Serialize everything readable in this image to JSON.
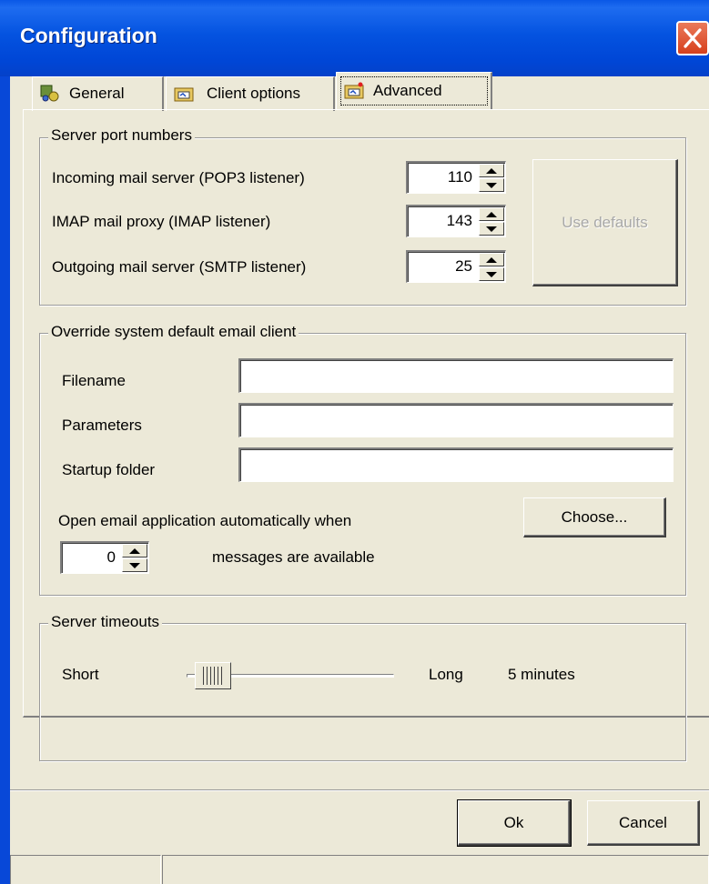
{
  "window": {
    "title": "Configuration"
  },
  "tabs": [
    {
      "label": "General",
      "icon": "general-settings-icon"
    },
    {
      "label": "Client options",
      "icon": "client-options-icon"
    },
    {
      "label": "Advanced",
      "icon": "advanced-icon",
      "active": true
    }
  ],
  "server_ports": {
    "title": "Server port numbers",
    "rows": [
      {
        "label": "Incoming mail server (POP3 listener)",
        "value": "110"
      },
      {
        "label": "IMAP mail proxy (IMAP listener)",
        "value": "143"
      },
      {
        "label": "Outgoing mail server (SMTP listener)",
        "value": "25"
      }
    ],
    "use_defaults_label": "Use defaults"
  },
  "override_client": {
    "title": "Override system default email client",
    "filename_label": "Filename",
    "filename_value": "",
    "parameters_label": "Parameters",
    "parameters_value": "",
    "startup_label": "Startup folder",
    "startup_value": "",
    "open_auto_label": "Open email application automatically when",
    "choose_label": "Choose...",
    "messages_count": "0",
    "messages_label": "messages are available"
  },
  "timeouts": {
    "title": "Server timeouts",
    "short_label": "Short",
    "long_label": "Long",
    "current_value": "5 minutes",
    "slider_level": 0.1
  },
  "footer": {
    "ok_label": "Ok",
    "cancel_label": "Cancel"
  },
  "colors": {
    "titlebar": "#0453E0",
    "face": "#ECE9D8",
    "close": "#D7401C"
  }
}
